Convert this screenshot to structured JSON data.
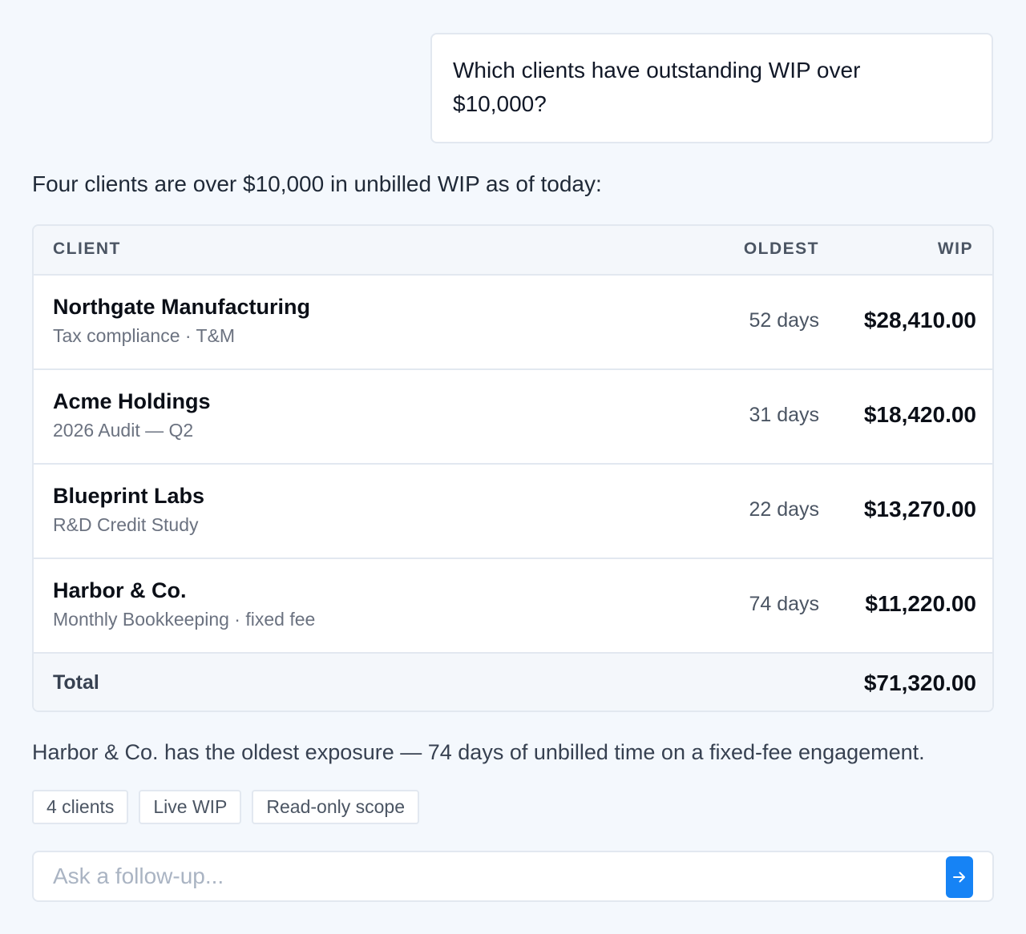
{
  "user_message": "Which clients have outstanding WIP over $10,000?",
  "intro": "Four clients are over $10,000 in unbilled WIP as of today:",
  "table": {
    "headers": {
      "client": "CLIENT",
      "oldest": "OLDEST",
      "wip": "WIP"
    },
    "rows": [
      {
        "name": "Northgate Manufacturing",
        "detail": "Tax compliance · T&M",
        "oldest": "52 days",
        "wip": "$28,410.00"
      },
      {
        "name": "Acme Holdings",
        "detail": "2026 Audit — Q2",
        "oldest": "31 days",
        "wip": "$18,420.00"
      },
      {
        "name": "Blueprint Labs",
        "detail": "R&D Credit Study",
        "oldest": "22 days",
        "wip": "$13,270.00"
      },
      {
        "name": "Harbor & Co.",
        "detail": "Monthly Bookkeeping · fixed fee",
        "oldest": "74 days",
        "wip": "$11,220.00"
      }
    ],
    "total_label": "Total",
    "total_value": "$71,320.00"
  },
  "summary": "Harbor & Co. has the oldest exposure — 74 days of unbilled time on a fixed-fee engagement.",
  "chips": [
    "4 clients",
    "Live WIP",
    "Read-only scope"
  ],
  "composer": {
    "placeholder": "Ask a follow-up...",
    "value": "",
    "send_icon": "arrow-right-icon"
  },
  "colors": {
    "background": "#f4f8fd",
    "accent": "#1683f5",
    "border": "#e2e8f0"
  }
}
